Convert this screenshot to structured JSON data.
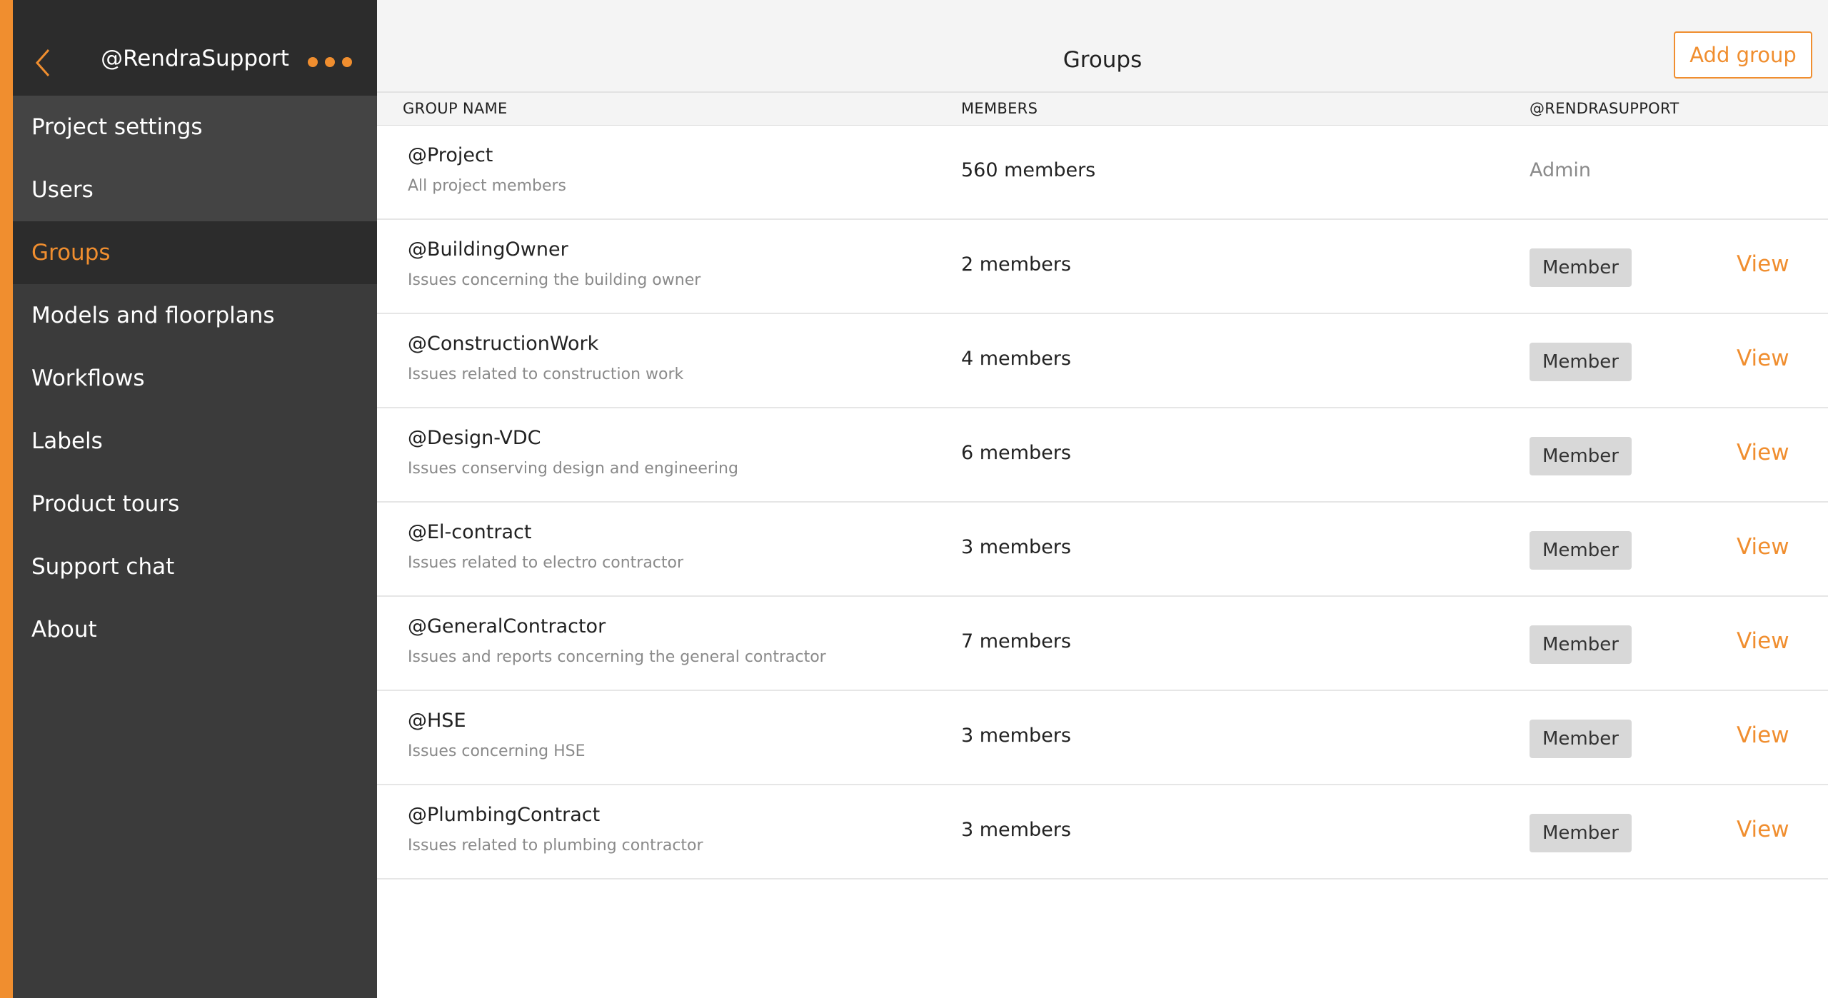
{
  "sidebar": {
    "title": "@RendraSupport",
    "back_icon": "chevron-left-icon",
    "more_icon": "more-dots-icon",
    "items": [
      {
        "label": "Project settings"
      },
      {
        "label": "Users"
      },
      {
        "label": "Groups",
        "active": true
      },
      {
        "label": "Models and floorplans"
      },
      {
        "label": "Workflows"
      },
      {
        "label": "Labels"
      },
      {
        "label": "Product tours"
      },
      {
        "label": "Support chat"
      },
      {
        "label": "About"
      }
    ]
  },
  "header": {
    "title": "Groups",
    "add_button": "Add group"
  },
  "table": {
    "columns": [
      "GROUP NAME",
      "MEMBERS",
      "@RENDRASUPPORT"
    ],
    "rows": [
      {
        "name": "@Project",
        "description": "All project members",
        "members": "560 members",
        "role": "Admin",
        "action": ""
      },
      {
        "name": "@BuildingOwner",
        "description": "Issues concerning the building owner",
        "members": "2 members",
        "role": "Member",
        "action": "View"
      },
      {
        "name": "@ConstructionWork",
        "description": "Issues related to construction work",
        "members": "4 members",
        "role": "Member",
        "action": "View"
      },
      {
        "name": "@Design-VDC",
        "description": "Issues conserving design and engineering",
        "members": "6 members",
        "role": "Member",
        "action": "View"
      },
      {
        "name": "@El-contract",
        "description": "Issues related to electro contractor",
        "members": "3 members",
        "role": "Member",
        "action": "View"
      },
      {
        "name": "@GeneralContractor",
        "description": "Issues and reports concerning the general contractor",
        "members": "7 members",
        "role": "Member",
        "action": "View"
      },
      {
        "name": "@HSE",
        "description": "Issues concerning HSE",
        "members": "3 members",
        "role": "Member",
        "action": "View"
      },
      {
        "name": "@PlumbingContract",
        "description": "Issues related to plumbing contractor",
        "members": "3 members",
        "role": "Member",
        "action": "View"
      }
    ]
  },
  "colors": {
    "accent": "#f08e2f",
    "sidebar_bg": "#3b3b3b",
    "sidebar_header_bg": "#2c2c2c",
    "badge_bg": "#d8d8d8"
  }
}
